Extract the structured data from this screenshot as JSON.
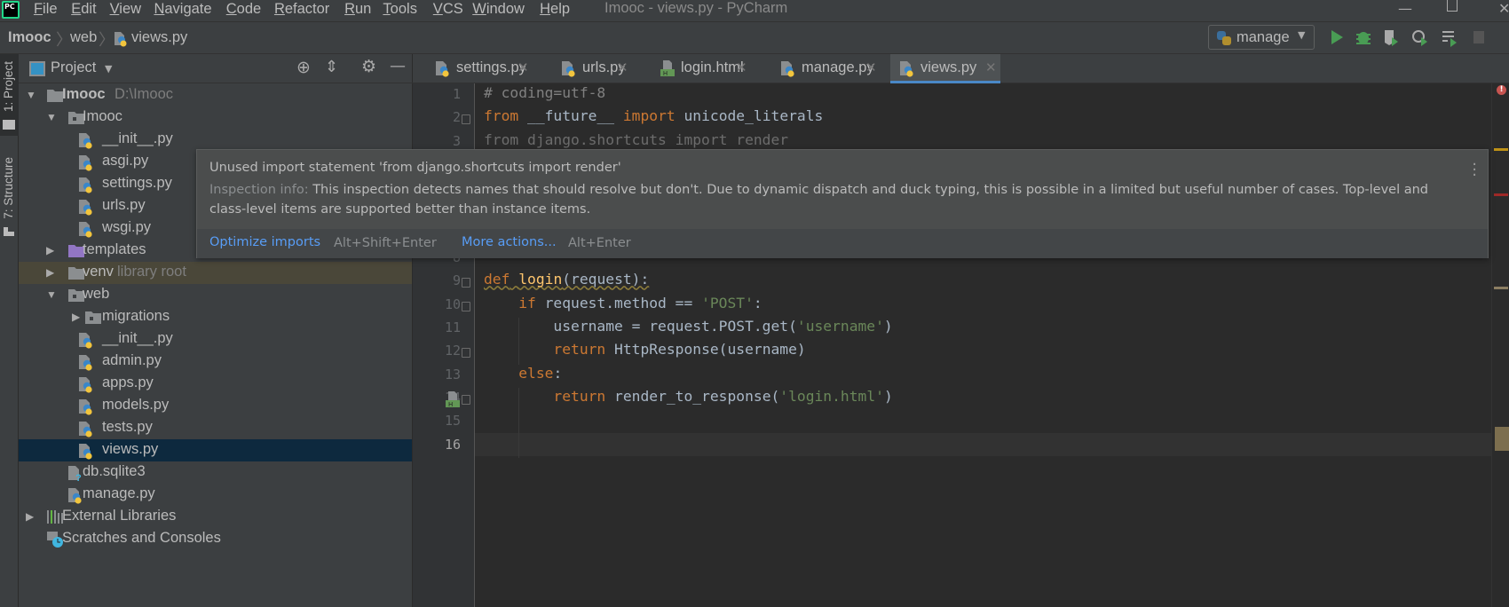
{
  "app": {
    "title": "Imooc - views.py - PyCharm",
    "logo_text": "PC"
  },
  "menu": [
    "File",
    "Edit",
    "View",
    "Navigate",
    "Code",
    "Refactor",
    "Run",
    "Tools",
    "VCS",
    "Window",
    "Help"
  ],
  "breadcrumb": [
    "Imooc",
    "web",
    "views.py"
  ],
  "run_config": {
    "label": "manage"
  },
  "toolbar_icons": [
    "run-icon",
    "debug-icon",
    "coverage-icon",
    "profile-icon",
    "concurrency-icon",
    "stop-icon"
  ],
  "tool_windows": {
    "project": "1: Project",
    "structure": "7: Structure"
  },
  "project_panel": {
    "title": "Project"
  },
  "tree": [
    {
      "label": "Imooc",
      "hint": "D:\\Imooc",
      "level": 0,
      "arrow": "open",
      "icon": "folder",
      "bold": true
    },
    {
      "label": "Imooc",
      "level": 1,
      "arrow": "open",
      "icon": "package"
    },
    {
      "label": "__init__.py",
      "level": 2,
      "icon": "python"
    },
    {
      "label": "asgi.py",
      "level": 2,
      "icon": "python"
    },
    {
      "label": "settings.py",
      "level": 2,
      "icon": "python"
    },
    {
      "label": "urls.py",
      "level": 2,
      "icon": "python"
    },
    {
      "label": "wsgi.py",
      "level": 2,
      "icon": "python"
    },
    {
      "label": "templates",
      "level": 1,
      "arrow": "closed",
      "icon": "folder-templates"
    },
    {
      "label": "venv",
      "hint": "library root",
      "level": 1,
      "arrow": "closed",
      "icon": "folder",
      "libroot": true
    },
    {
      "label": "web",
      "level": 1,
      "arrow": "open",
      "icon": "package"
    },
    {
      "label": "migrations",
      "level": 2,
      "arrow": "closed",
      "icon": "package"
    },
    {
      "label": "__init__.py",
      "level": 2,
      "icon": "python"
    },
    {
      "label": "admin.py",
      "level": 2,
      "icon": "python"
    },
    {
      "label": "apps.py",
      "level": 2,
      "icon": "python"
    },
    {
      "label": "models.py",
      "level": 2,
      "icon": "python"
    },
    {
      "label": "tests.py",
      "level": 2,
      "icon": "python"
    },
    {
      "label": "views.py",
      "level": 2,
      "icon": "python",
      "selected": true
    },
    {
      "label": "db.sqlite3",
      "level": 1,
      "icon": "unknown"
    },
    {
      "label": "manage.py",
      "level": 1,
      "icon": "python"
    },
    {
      "label": "External Libraries",
      "level": 0,
      "arrow": "closed",
      "icon": "libraries"
    },
    {
      "label": "Scratches and Consoles",
      "level": 0,
      "icon": "scratches"
    }
  ],
  "tabs": [
    {
      "label": "settings.py",
      "icon": "python"
    },
    {
      "label": "urls.py",
      "icon": "python"
    },
    {
      "label": "login.html",
      "icon": "html"
    },
    {
      "label": "manage.py",
      "icon": "python"
    },
    {
      "label": "views.py",
      "icon": "python",
      "active": true
    }
  ],
  "code": [
    {
      "num": 1,
      "tokens": [
        [
          "# coding=utf-8",
          "cm"
        ]
      ]
    },
    {
      "num": 2,
      "tokens": [
        [
          "from",
          "kw"
        ],
        [
          " __future__ ",
          ""
        ],
        [
          "import",
          "kw"
        ],
        [
          " unicode_literals",
          ""
        ]
      ]
    },
    {
      "num": 3,
      "tokens": [
        [
          "from django.shortcuts import render",
          "unused"
        ]
      ]
    },
    {
      "num": 8,
      "tokens": []
    },
    {
      "num": 9,
      "tokens": [
        [
          "def",
          "kw warn"
        ],
        [
          " ",
          "warn"
        ],
        [
          "login",
          "fn warn"
        ],
        [
          "(request):",
          "warn"
        ]
      ]
    },
    {
      "num": 10,
      "tokens": [
        [
          "    ",
          ""
        ],
        [
          "if",
          "kw"
        ],
        [
          " request.method == ",
          ""
        ],
        [
          "'POST'",
          "str"
        ],
        [
          ":",
          ""
        ]
      ]
    },
    {
      "num": 11,
      "tokens": [
        [
          "        username = request.POST.get(",
          ""
        ],
        [
          "'username'",
          "str"
        ],
        [
          ")",
          ""
        ]
      ]
    },
    {
      "num": 12,
      "tokens": [
        [
          "        ",
          ""
        ],
        [
          "return",
          "kw"
        ],
        [
          " HttpResponse(username)",
          ""
        ]
      ]
    },
    {
      "num": 13,
      "tokens": [
        [
          "    ",
          ""
        ],
        [
          "else",
          "kw"
        ],
        [
          ":",
          ""
        ]
      ]
    },
    {
      "num": 14,
      "tokens": [
        [
          "        ",
          ""
        ],
        [
          "return",
          "kw"
        ],
        [
          " render_to_response(",
          ""
        ],
        [
          "'login.html'",
          "str"
        ],
        [
          ")",
          ""
        ]
      ]
    },
    {
      "num": 15,
      "tokens": []
    },
    {
      "num": 16,
      "tokens": [],
      "current": true
    }
  ],
  "inspection_popup": {
    "title": "Unused import statement 'from django.shortcuts import render'",
    "info_label": "Inspection info:",
    "info_text": " This inspection detects names that should resolve but don't. Due to dynamic dispatch and duck typing, this is possible in a limited but useful number of cases. Top-level and class-level items are supported better than instance items.",
    "action1": "Optimize imports",
    "action1_key": "Alt+Shift+Enter",
    "action2": "More actions...",
    "action2_key": "Alt+Enter"
  },
  "colors": {
    "accent": "#4a88c7",
    "keyword": "#cc7832",
    "string": "#6a8759",
    "function": "#ffc66d",
    "link": "#589df6",
    "selection": "#0d293e",
    "run": "#499c54"
  }
}
